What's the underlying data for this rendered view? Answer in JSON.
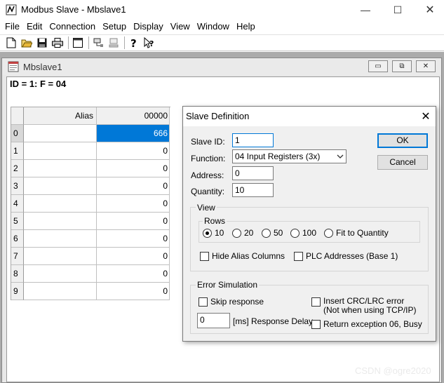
{
  "app": {
    "title": "Modbus Slave - Mbslave1",
    "min_glyph": "—",
    "max_glyph": "☐",
    "close_glyph": "✕"
  },
  "menu": [
    "File",
    "Edit",
    "Connection",
    "Setup",
    "Display",
    "View",
    "Window",
    "Help"
  ],
  "toolbar": {
    "icons": [
      "new-icon",
      "open-icon",
      "save-icon",
      "print-icon",
      "window-icon",
      "connect-icon",
      "disconnect-icon",
      "help-icon",
      "context-help-icon"
    ]
  },
  "child": {
    "title": "Mbslave1",
    "status": "ID = 1: F = 04",
    "ctrl_min": "▭",
    "ctrl_restore": "⧉",
    "ctrl_close": "✕"
  },
  "grid": {
    "col_alias": "Alias",
    "col_value": "00000",
    "rows": [
      {
        "index": "0",
        "alias": "",
        "value": "666"
      },
      {
        "index": "1",
        "alias": "",
        "value": "0"
      },
      {
        "index": "2",
        "alias": "",
        "value": "0"
      },
      {
        "index": "3",
        "alias": "",
        "value": "0"
      },
      {
        "index": "4",
        "alias": "",
        "value": "0"
      },
      {
        "index": "5",
        "alias": "",
        "value": "0"
      },
      {
        "index": "6",
        "alias": "",
        "value": "0"
      },
      {
        "index": "7",
        "alias": "",
        "value": "0"
      },
      {
        "index": "8",
        "alias": "",
        "value": "0"
      },
      {
        "index": "9",
        "alias": "",
        "value": "0"
      }
    ]
  },
  "dialog": {
    "title": "Slave Definition",
    "close_glyph": "✕",
    "slave_id_label": "Slave ID:",
    "slave_id_value": "1",
    "function_label": "Function:",
    "function_value": "04 Input Registers (3x)",
    "address_label": "Address:",
    "address_value": "0",
    "quantity_label": "Quantity:",
    "quantity_value": "10",
    "ok_label": "OK",
    "cancel_label": "Cancel",
    "view_group": "View",
    "rows_group": "Rows",
    "rows_options": [
      "10",
      "20",
      "50",
      "100",
      "Fit to Quantity"
    ],
    "rows_selected": "10",
    "hide_alias_label": "Hide Alias Columns",
    "plc_addresses_label": "PLC Addresses (Base 1)",
    "error_group": "Error Simulation",
    "skip_response_label": "Skip response",
    "insert_crc_label": "Insert CRC/LRC error",
    "insert_crc_note": "(Not when using TCP/IP)",
    "delay_value": "0",
    "delay_label": "[ms] Response Delay",
    "return_exception_label": "Return exception 06, Busy"
  },
  "watermark": "CSDN @ogre2020"
}
